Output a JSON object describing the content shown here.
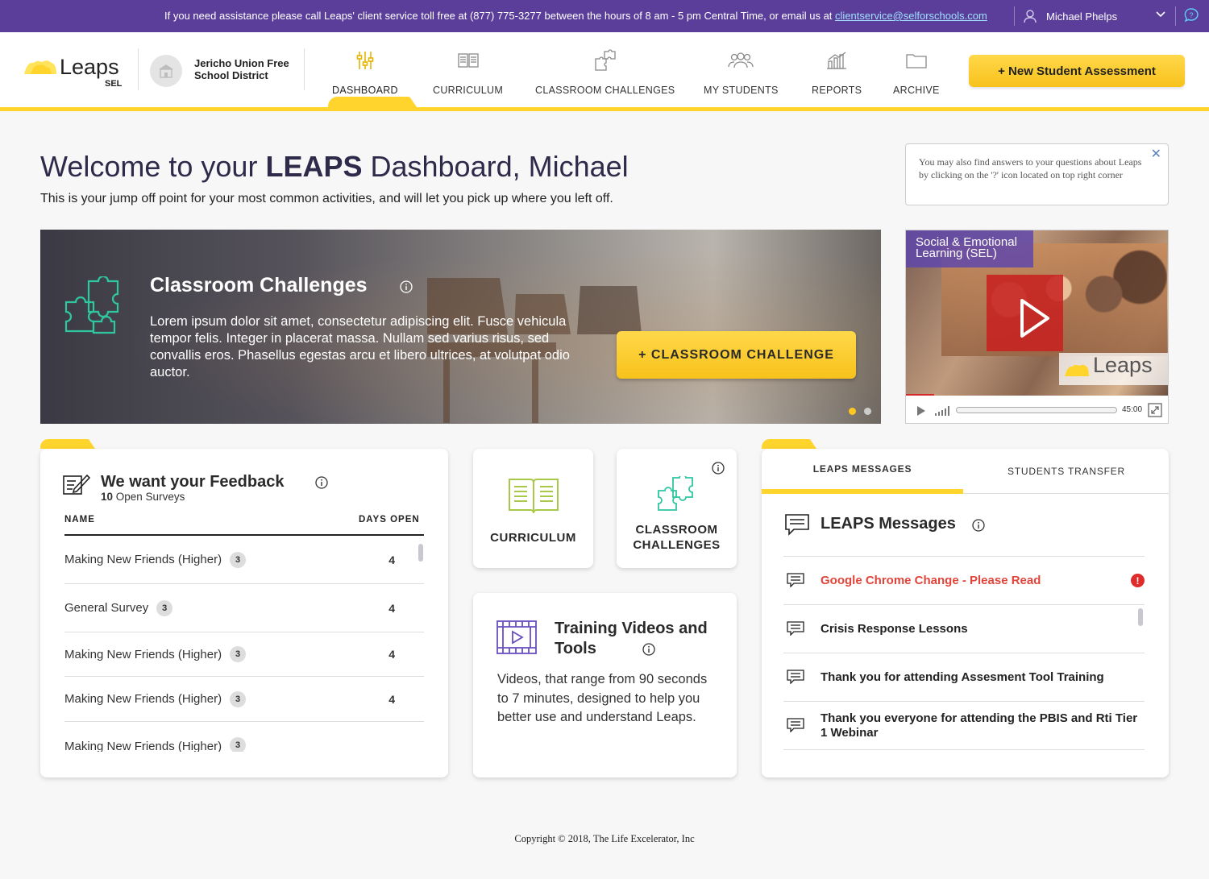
{
  "topbar": {
    "assist_text": "If you need assistance please call Leaps' client service toll free at (877) 775-3277 between the hours of 8 am - 5 pm Central Time, or email us at ",
    "email": "clientservice@selforschools.com",
    "user_name": "Michael Phelps"
  },
  "header": {
    "logo_word": "Leaps",
    "logo_sub": "SEL",
    "district": "Jericho Union Free School District",
    "nav": [
      {
        "label": "DASHBOARD",
        "icon": "sliders-icon",
        "active": true
      },
      {
        "label": "CURRICULUM",
        "icon": "book-icon"
      },
      {
        "label": "CLASSROOM CHALLENGES",
        "icon": "puzzle-icon"
      },
      {
        "label": "MY STUDENTS",
        "icon": "people-icon"
      },
      {
        "label": "REPORTS",
        "icon": "bar-chart-icon"
      },
      {
        "label": "ARCHIVE",
        "icon": "folder-icon"
      }
    ],
    "new_button": "+ New Student Assessment"
  },
  "welcome": {
    "title_pre": "Welcome to your ",
    "title_bold": "LEAPS",
    "title_post": " Dashboard, Michael",
    "subtitle": "This is your jump off point for your most common activities, and will let you pick up where you left off."
  },
  "tip": {
    "text": "You may also find answers to your questions about Leaps by clicking on the '?' icon located on top right corner"
  },
  "hero": {
    "title": "Classroom Challenges",
    "body": "Lorem ipsum dolor sit amet, consectetur adipiscing elit. Fusce vehicula tempor felis. Integer in placerat massa. Nullam sed varius risus, sed convallis eros. Phasellus egestas arcu et libero ultrices, at volutpat odio auctor.",
    "button": "+ CLASSROOM CHALLENGE",
    "slides": 2,
    "active_slide": 1
  },
  "video": {
    "title": "Social & Emotional Learning (SEL)",
    "watermark": "Leaps",
    "duration": "45:00"
  },
  "feedback": {
    "title": "We want your Feedback",
    "open_count": "10",
    "open_label": " Open Surveys",
    "col_name": "NAME",
    "col_days": "DAYS OPEN",
    "rows": [
      {
        "name": "Making New Friends (Higher)",
        "badge": "3",
        "days": "4"
      },
      {
        "name": "General Survey",
        "badge": "3",
        "days": "4"
      },
      {
        "name": "Making New Friends (Higher)",
        "badge": "3",
        "days": "4"
      },
      {
        "name": "Making New Friends (Higher)",
        "badge": "3",
        "days": "4"
      },
      {
        "name": "Making New Friends (Higher)",
        "badge": "3",
        "days": ""
      }
    ]
  },
  "tiles": {
    "curriculum": "CURRICULUM",
    "challenges_1": "CLASSROOM",
    "challenges_2": "CHALLENGES"
  },
  "training": {
    "title": "Training Videos and Tools",
    "body": "Videos, that range from 90 seconds to 7 minutes, designed to help you better use and understand Leaps."
  },
  "messages": {
    "tab_messages": "LEAPS MESSAGES",
    "tab_transfer": "STUDENTS TRANSFER",
    "title": "LEAPS Messages",
    "items": [
      {
        "text": "Google Chrome Change - Please Read",
        "alert": true
      },
      {
        "text": "Crisis Response Lessons"
      },
      {
        "text": "Thank you for attending Assesment Tool Training"
      },
      {
        "text": "Thank you everyone for attending the PBIS and Rti Tier 1 Webinar"
      }
    ]
  },
  "footer": {
    "text": "Copyright © 2018, The Life Excelerator, Inc"
  },
  "colors": {
    "topbar": "#5a3e9a",
    "accent_yellow": "#ffd42c",
    "alert_red": "#e0443a",
    "teal_icon": "#2fc7a0",
    "olive_icon": "#a8c84a",
    "purple_icon": "#6a4fc0"
  }
}
